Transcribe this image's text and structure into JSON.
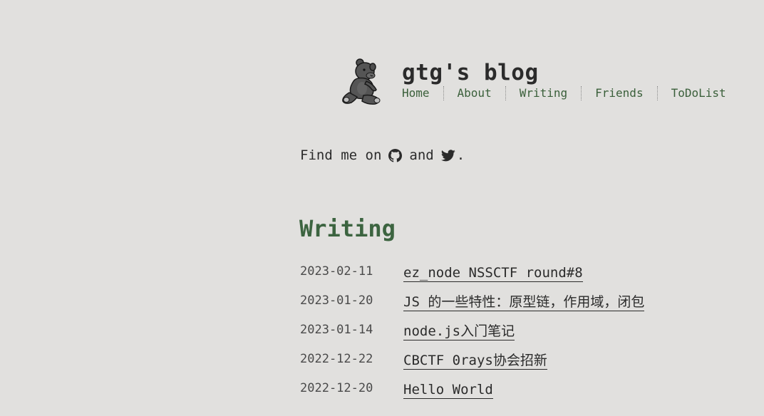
{
  "site": {
    "title": "gtg's blog"
  },
  "nav": {
    "items": [
      {
        "label": "Home"
      },
      {
        "label": "About"
      },
      {
        "label": "Writing"
      },
      {
        "label": "Friends"
      },
      {
        "label": "ToDoList"
      }
    ]
  },
  "intro": {
    "prefix": "Find me on",
    "middle": "and",
    "suffix": ".",
    "links": [
      {
        "icon": "github-icon"
      },
      {
        "icon": "twitter-icon"
      }
    ]
  },
  "writing": {
    "heading": "Writing",
    "posts": [
      {
        "date": "2023-02-11",
        "title": "ez_node NSSCTF round#8"
      },
      {
        "date": "2023-01-20",
        "title": "JS 的一些特性：原型链，作用域，闭包"
      },
      {
        "date": "2023-01-14",
        "title": "node.js入门笔记"
      },
      {
        "date": "2022-12-22",
        "title": "CBCTF 0rays协会招新"
      },
      {
        "date": "2022-12-20",
        "title": "Hello World"
      }
    ]
  },
  "colors": {
    "background": "#e1e0de",
    "text": "#2b2b2b",
    "nav_link": "#3a5f3a",
    "heading": "#3c6440"
  }
}
